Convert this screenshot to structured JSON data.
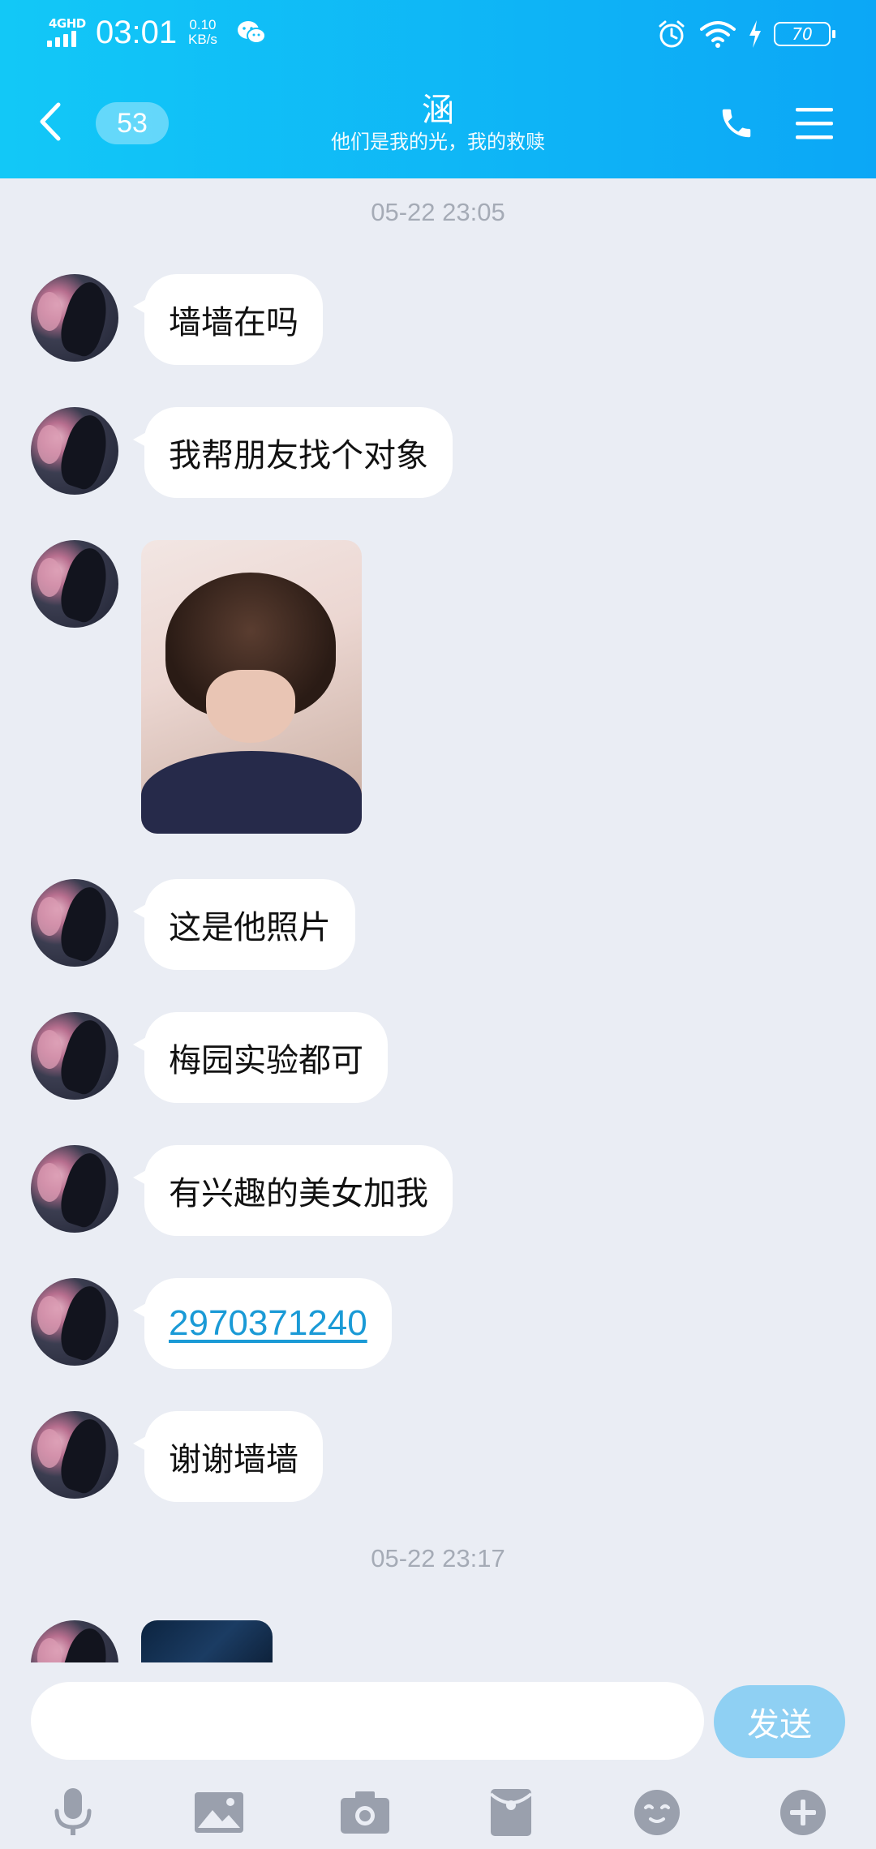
{
  "status_bar": {
    "network": "4GHD",
    "time": "03:01",
    "speed_value": "0.10",
    "speed_unit": "KB/s",
    "battery": "70"
  },
  "header": {
    "unread_count": "53",
    "title": "涵",
    "subtitle": "他们是我的光，我的救赎"
  },
  "chat": {
    "timestamps": [
      "05-22 23:05",
      "05-22 23:17"
    ],
    "messages": [
      {
        "type": "text",
        "text": "墙墙在吗"
      },
      {
        "type": "text",
        "text": "我帮朋友找个对象"
      },
      {
        "type": "image"
      },
      {
        "type": "text",
        "text": "这是他照片"
      },
      {
        "type": "text",
        "text": "梅园实验都可"
      },
      {
        "type": "text",
        "text": "有兴趣的美女加我"
      },
      {
        "type": "link",
        "text": "2970371240"
      },
      {
        "type": "text",
        "text": "谢谢墙墙"
      },
      {
        "type": "image"
      }
    ]
  },
  "input": {
    "send_label": "发送",
    "placeholder": ""
  },
  "toolbar": {
    "icons": [
      "microphone-icon",
      "image-icon",
      "camera-icon",
      "red-packet-icon",
      "emoji-icon",
      "plus-icon"
    ]
  },
  "colors": {
    "header_gradient_start": "#12c8f7",
    "header_gradient_end": "#0ca7f6",
    "background": "#eaedf4",
    "link": "#1a9ad6",
    "send_button": "#8fd0f3"
  }
}
